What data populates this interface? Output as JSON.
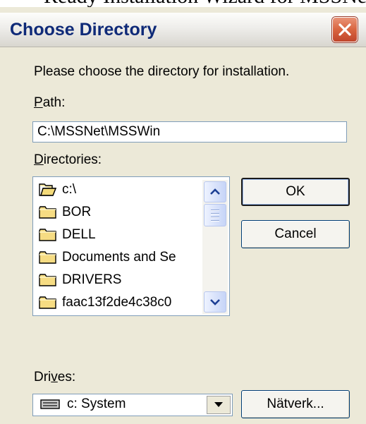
{
  "background_text": "Ready Installation Wizard for MSSNet",
  "window": {
    "title": "Choose Directory",
    "close_icon": "close-x-icon",
    "accent_color": "#0f2a78",
    "close_color": "#d9643f"
  },
  "instruction": "Please choose the directory for installation.",
  "path": {
    "label_hotkey": "P",
    "label_rest": "ath:",
    "value": "C:\\MSSNet\\MSSWin"
  },
  "directories": {
    "label_hotkey": "D",
    "label_rest": "irectories:",
    "items": [
      {
        "name": "c:\\",
        "icon": "open-folder-icon"
      },
      {
        "name": "BOR",
        "icon": "folder-icon"
      },
      {
        "name": "DELL",
        "icon": "folder-icon"
      },
      {
        "name": "Documents and Se",
        "icon": "folder-icon"
      },
      {
        "name": "DRIVERS",
        "icon": "folder-icon"
      },
      {
        "name": "faac13f2de4c38c0",
        "icon": "folder-icon"
      }
    ]
  },
  "buttons": {
    "ok": "OK",
    "cancel": "Cancel",
    "network": "Nätverk..."
  },
  "drives": {
    "label_prefix": "Dri",
    "label_hotkey": "v",
    "label_rest": "es:",
    "selected": "c: System",
    "icon": "hard-drive-icon"
  }
}
